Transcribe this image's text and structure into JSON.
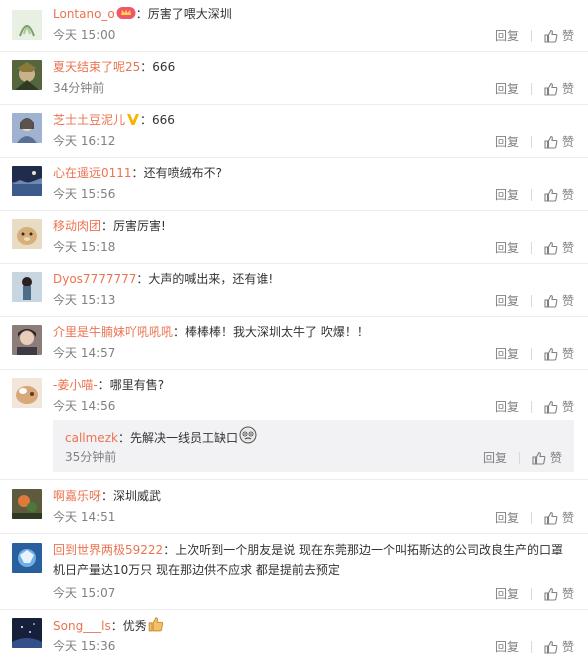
{
  "labels": {
    "reply": "回复",
    "like": "赞"
  },
  "comments": [
    {
      "user": "Lontano_o",
      "sep": "：",
      "text": "厉害了喂大深圳",
      "time": "今天 15:00",
      "avatar_color": "#d7e6cf"
    },
    {
      "user": "夏天结束了呢25",
      "sep": "：",
      "text": "666",
      "time": "34分钟前",
      "avatar_color": "#4b5a3c"
    },
    {
      "user": "芝士土豆泥儿",
      "sep": "：",
      "text": "666",
      "time": "今天 16:12",
      "avatar_color": "#8fa3c4"
    },
    {
      "user": "心在遥远0111",
      "sep": "：",
      "text": "还有喷绒布不?",
      "time": "今天 15:56",
      "avatar_color": "#3b4f78"
    },
    {
      "user": "移动肉团",
      "sep": "：",
      "text": "厉害厉害!",
      "time": "今天 15:18",
      "avatar_color": "#d9c39a"
    },
    {
      "user": "Dyos7777777",
      "sep": "：",
      "text": "大声的喊出来，还有谁!",
      "time": "今天 15:13",
      "avatar_color": "#9ab0c0"
    },
    {
      "user": "介里是牛腩妹吖吼吼吼",
      "sep": "：",
      "text": "棒棒棒！我大深圳太牛了 吹爆！！",
      "time": "今天 14:57",
      "avatar_color": "#7a6a66"
    },
    {
      "user": "-姜小喵-",
      "sep": "：",
      "text": "哪里有售?",
      "time": "今天 14:56",
      "avatar_color": "#d8b08c"
    },
    {
      "user": "啊嘉乐呀",
      "sep": "：",
      "text": "深圳威武",
      "time": "今天 14:51",
      "avatar_color": "#6a5a3a"
    },
    {
      "user": "回到世界两极59222",
      "sep": "：",
      "text": "上次听到一个朋友是说  现在东莞那边一个叫拓斯达的公司改良生产的口罩机日产量达10万只  现在那边供不应求  都是提前去预定",
      "time": "今天 15:07",
      "avatar_color": "#2f6fae"
    },
    {
      "user": "Song___ls",
      "sep": "：",
      "text": "优秀",
      "time": "今天 15:36",
      "avatar_color": "#1e2a4a"
    }
  ],
  "subreply": {
    "user": "callmezk",
    "sep": "：",
    "text": "先解决一线员工缺口",
    "time": "35分钟前"
  },
  "colors": {
    "username": "#eb7350",
    "time": "#808080",
    "subbox": "#f2f2f5",
    "vip_badge": "#f7b500"
  }
}
